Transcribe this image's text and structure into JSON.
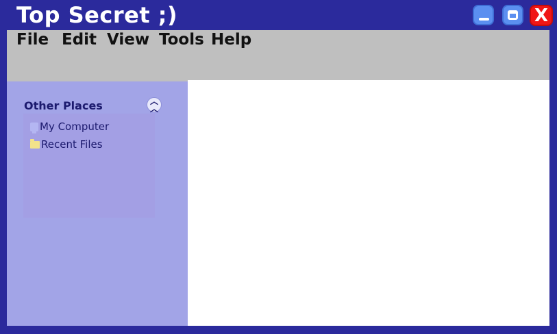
{
  "window": {
    "title": "Top Secret ;)",
    "controls": {
      "minimize_icon": "minimize-icon",
      "maximize_icon": "maximize-icon",
      "close_icon": "close-icon",
      "close_glyph": "X"
    },
    "colors": {
      "frame": "#2b2a9c",
      "menubar": "#bfbfbf",
      "sidebar": "#a2a4e7",
      "close": "#f01616",
      "window_buttons": "#5b8ff0"
    }
  },
  "menu": {
    "items": [
      "File",
      "Edit",
      "View",
      "Tools",
      "Help"
    ]
  },
  "sidebar": {
    "panel_title": "Other Places",
    "collapse_icon": "double-chevron-up-icon",
    "places": [
      {
        "label": "My Computer",
        "icon": "computer-icon"
      },
      {
        "label": "Recent Files",
        "icon": "folder-icon"
      }
    ]
  }
}
